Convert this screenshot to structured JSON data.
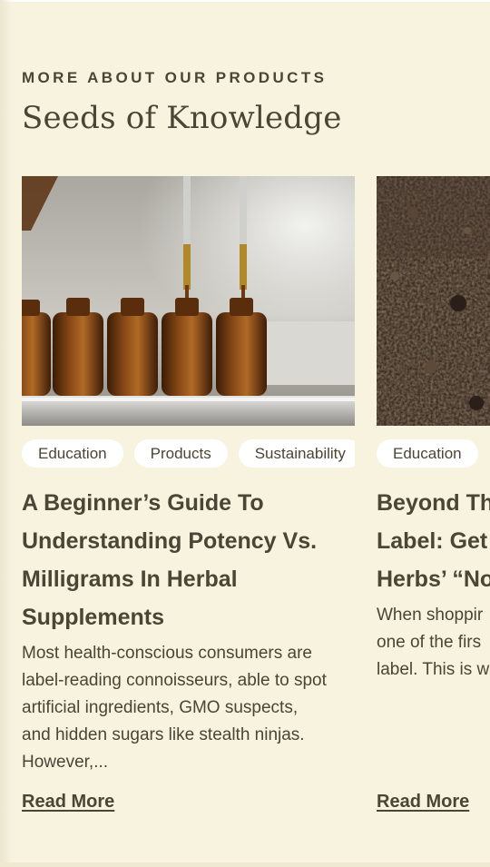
{
  "section": {
    "eyebrow": "MORE ABOUT OUR PRODUCTS",
    "heading": "Seeds of Knowledge"
  },
  "cards": [
    {
      "image": "amber-dropper-bottles-photo",
      "tags": [
        "Education",
        "Products",
        "Sustainability"
      ],
      "title_lines": [
        "A Beginner’s Guide To",
        "Understanding Potency Vs.",
        "Milligrams In Herbal",
        "Supplements"
      ],
      "excerpt_lines": [
        "Most health-conscious consumers are",
        "label-reading connoisseurs, able to spot",
        "artificial ingredients, GMO suspects,",
        "and hidden sugars like stealth ninjas.",
        "However,..."
      ],
      "read_more": "Read More"
    },
    {
      "image": "dark-soil-photo",
      "tags": [
        "Education"
      ],
      "title_lines": [
        "Beyond Th",
        "Label: Get",
        "Herbs’ “No"
      ],
      "excerpt_lines": [
        "When shoppir",
        "one of the firs",
        "label. This is w"
      ],
      "read_more": "Read More"
    }
  ],
  "colors": {
    "background": "#f7f3df",
    "text": "#4a4535",
    "tag_background": "#ffffff"
  }
}
